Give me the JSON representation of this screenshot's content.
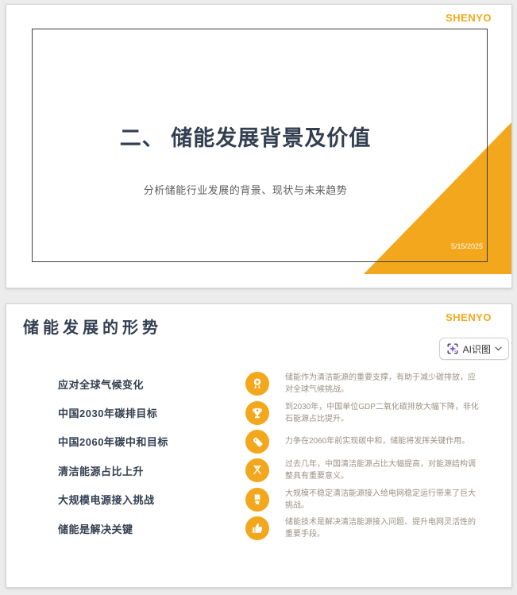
{
  "brand": {
    "name": "SHENYO",
    "color": "#f5a81c"
  },
  "accent_color": "#f2a71d",
  "slide1": {
    "logo": "SHENYO",
    "title": "二、 储能发展背景及价值",
    "subtitle": "分析储能行业发展的背景、现状与未来趋势",
    "date": "5/15/2025"
  },
  "slide2": {
    "logo": "SHENYO",
    "title": "储能发展的形势",
    "ai_button": {
      "label": "AI识图",
      "icon": "ai-scan-sparkle-icon",
      "chevron": "chevron-down-icon"
    },
    "items": [
      {
        "icon": "award-ribbon-icon",
        "label": "应对全球气候变化",
        "desc": "储能作为清洁能源的重要支撑，有助于减少碳排放，应对全球气候挑战。"
      },
      {
        "icon": "trophy-icon",
        "label": "中国2030年碳排目标",
        "desc": "到2030年，中国单位GDP二氧化碳排放大幅下降，非化石能源占比提升。"
      },
      {
        "icon": "tag-icon",
        "label": "中国2060年碳中和目标",
        "desc": "力争在2060年前实现碳中和，储能将发挥关键作用。"
      },
      {
        "icon": "crossed-flags-icon",
        "label": "清洁能源占比上升",
        "desc": "过去几年，中国清洁能源占比大幅提高，对能源结构调整具有重要意义。"
      },
      {
        "icon": "medal-star-icon",
        "label": "大规模电源接入挑战",
        "desc": "大规模不稳定清洁能源接入给电网稳定运行带来了巨大挑战。"
      },
      {
        "icon": "thumbs-up-icon",
        "label": "储能是解决关键",
        "desc": "储能技术是解决清洁能源接入问题、提升电网灵活性的重要手段。"
      }
    ]
  }
}
